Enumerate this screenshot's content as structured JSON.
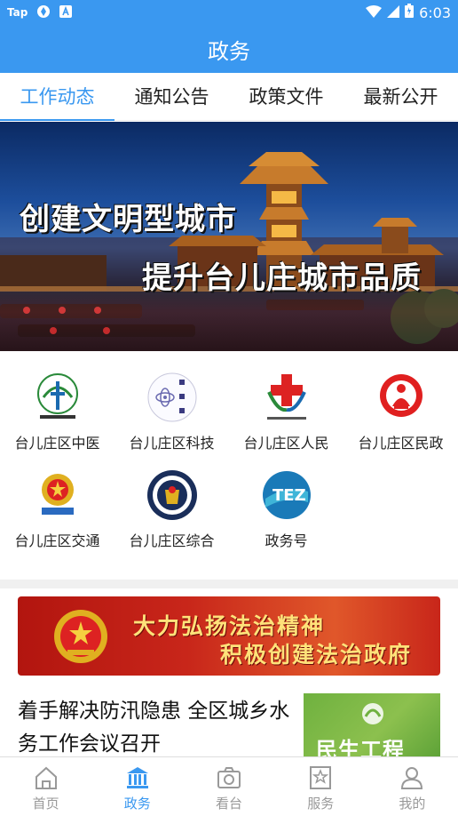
{
  "status_bar": {
    "left_items": [
      "Tap"
    ],
    "time": "6:03"
  },
  "app_bar": {
    "title": "政务"
  },
  "tabs": [
    {
      "label": "工作动态",
      "active": true
    },
    {
      "label": "通知公告",
      "active": false
    },
    {
      "label": "政策文件",
      "active": false
    },
    {
      "label": "最新公开",
      "active": false
    }
  ],
  "banner": {
    "line1": "创建文明型城市",
    "line2": "提升台儿庄城市品质"
  },
  "departments": [
    {
      "label": "台儿庄区中医",
      "icon": "hospital-logo-icon"
    },
    {
      "label": "台儿庄区科技",
      "icon": "science-bureau-logo-icon"
    },
    {
      "label": "台儿庄区人民",
      "icon": "peoples-hospital-logo-icon"
    },
    {
      "label": "台儿庄区民政",
      "icon": "civil-affairs-logo-icon"
    },
    {
      "label": "台儿庄区交通",
      "icon": "transport-emblem-icon"
    },
    {
      "label": "台儿庄区综合",
      "icon": "law-enforcement-emblem-icon"
    },
    {
      "label": "政务号",
      "icon": "tez-logo-icon"
    }
  ],
  "promo_banner": {
    "line1": "大力弘扬法治精神",
    "line2": "积极创建法治政府"
  },
  "news": [
    {
      "title": "着手解决防汛隐患 全区城乡水务工作会议召开",
      "thumb_text": "民生工程"
    }
  ],
  "bottom_nav": [
    {
      "label": "首页",
      "icon": "home-icon",
      "active": false
    },
    {
      "label": "政务",
      "icon": "government-building-icon",
      "active": true
    },
    {
      "label": "看台",
      "icon": "camera-icon",
      "active": false
    },
    {
      "label": "服务",
      "icon": "bookmark-star-icon",
      "active": false
    },
    {
      "label": "我的",
      "icon": "person-icon",
      "active": false
    }
  ],
  "colors": {
    "primary": "#3a98f0",
    "inactive_nav": "#999999",
    "promo_red": "#c8261a",
    "promo_text": "#ffe27a"
  }
}
